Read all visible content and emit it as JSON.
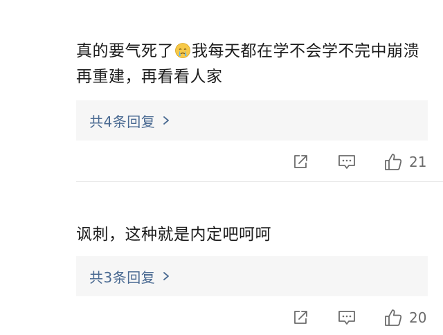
{
  "comments": [
    {
      "text_before_emoji": "真的要气死了",
      "emoji": "crying-face-emoji",
      "text_after_emoji": "我每天都在学不会学不完中崩溃再重建，再看看人家",
      "replies_label": "共4条回复",
      "likes": "21"
    },
    {
      "text_before_emoji": "讽刺，这种就是内定吧呵呵",
      "emoji": "",
      "text_after_emoji": "",
      "replies_label": "共3条回复",
      "likes": "20"
    }
  ],
  "colors": {
    "reply_link": "#4a6a92",
    "reply_bg": "#f6f6f6",
    "icon": "#6b6b6b",
    "divider": "#e6e6e6"
  },
  "icons": {
    "share": "share-icon",
    "comment": "comment-icon",
    "like": "thumbs-up-icon",
    "chevron": "chevron-right-icon"
  }
}
